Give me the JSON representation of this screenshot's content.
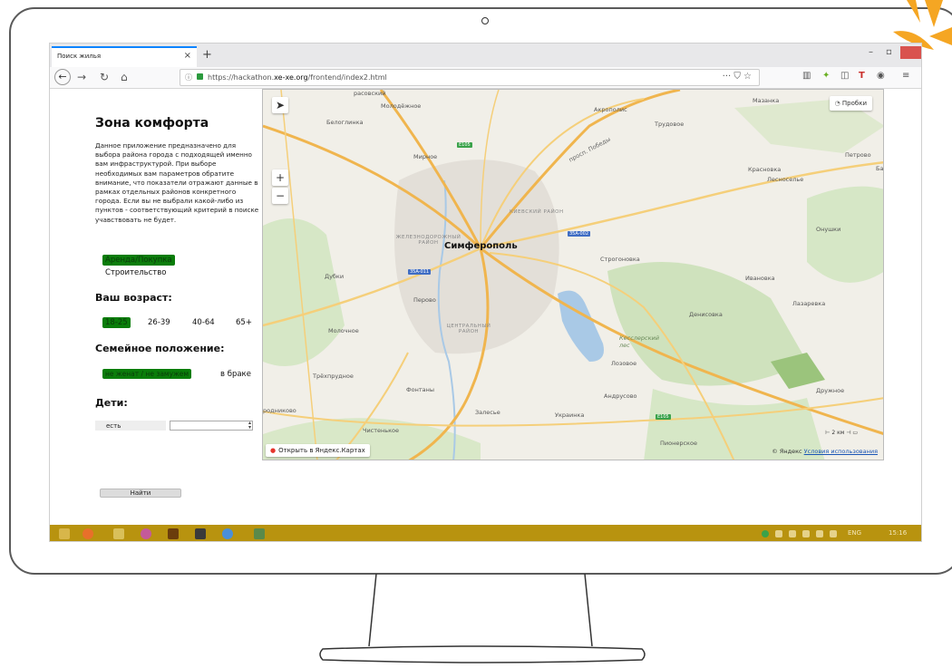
{
  "browser": {
    "tab_title": "Поиск жилья",
    "tab_close": "×",
    "new_tab": "+",
    "url_prefix": "https://hackathon.",
    "url_domain": "xe-xe.org",
    "url_path": "/frontend/index2.html",
    "url_more": "··· ⛉ ☆",
    "minimize": "–",
    "restore": "▫"
  },
  "app": {
    "title": "Зона комфорта",
    "description": "Данное приложение предназначено для выбора района города с подходящей именно вам инфраструктурой. При выборе необходимых вам параметров обратите внимание, что показатели отражают данные в рамках отдельных районов конкретного города. Если вы не выбрали какой-либо из пунктов - соответствующий критерий в поиске учавствовать не будет.",
    "purpose_options": [
      "Аренда/Покупка",
      "Строительство"
    ],
    "age_heading": "Ваш возраст:",
    "age_options": [
      "18-25",
      "26-39",
      "40-64",
      "65+"
    ],
    "family_heading": "Семейное положение:",
    "family_options": [
      "не женат / не замужем",
      "в браке"
    ],
    "children_heading": "Дети:",
    "children_select": "есть",
    "children_count_value": "",
    "find_button": "Найти"
  },
  "map": {
    "city": "Симферополь",
    "labels": {
      "molodezhnoe": "Молодёжное",
      "belogliinka": "Белоглинка",
      "akropolis": "Акрополис",
      "trudovoe": "Трудовое",
      "mazanka": "Мазанка",
      "petrovo": "Петрово",
      "krasnovka": "Красновка",
      "lesnoselye": "Лесноселье",
      "mirnoe": "Мирное",
      "kievsky": "КИЕВСКИЙ РАЙОН",
      "zheleznodorozhny": "ЖЕЛЕЗНОДОРОЖНЫЙ РАЙОН",
      "dubki": "Дубки",
      "perovo": "Перово",
      "stroganovka": "Строгоновка",
      "ivanovka": "Ивановка",
      "lazarevka": "Лазаревка",
      "denisovka": "Денисовка",
      "molochnoe": "Молочное",
      "tsentralny": "ЦЕНТРАЛЬНЫЙ РАЙОН",
      "kessler": "Кесслерский лес",
      "lozovoe": "Лозовое",
      "trekhprudnoe": "Трёхпрудное",
      "fontany": "Фонтаны",
      "andrusovo": "Андрусово",
      "druzhnoe": "Дружное",
      "zalesye": "Залесье",
      "ukrainka": "Украинка",
      "chistenkoe": "Чистенькое",
      "pionerskoe": "Пионерское",
      "onushki": "Онушки",
      "prospekt": "просп. Победы",
      "rodnikovoe": "родниково",
      "top_name": "расовский",
      "bar_edge": "Бар"
    },
    "road_badges": [
      "E105",
      "35A-002",
      "35A-011",
      "E105"
    ],
    "traffic_button": "Пробки",
    "open_in_yandex": "Открыть в Яндекс.Картах",
    "copyright": "© Яндекс",
    "terms_link": "Условия использования",
    "scale_label": "2 км",
    "zoom_in": "+",
    "zoom_out": "−",
    "locate": "➤"
  },
  "taskbar": {
    "lang": "ENG",
    "time": "15:16"
  },
  "colors": {
    "selected_option": "#0a7d0a",
    "taskbar": "#b8930f",
    "accent_orange": "#f5a623"
  }
}
